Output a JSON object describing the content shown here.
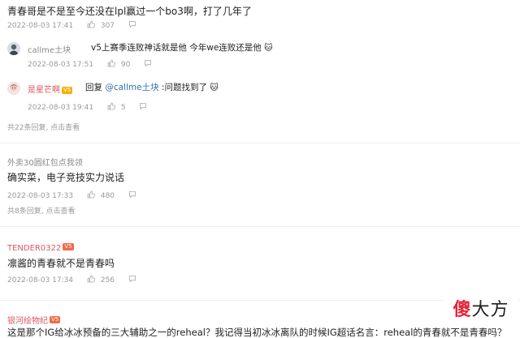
{
  "comments": [
    {
      "text": "青春哥是不是至今还没在lpl赢过一个bo3啊，打了几年了",
      "date": "2022-08-03 17:41",
      "likes": "307",
      "replies": [
        {
          "username": "callme土块",
          "content": "v5上赛季连败神话就是他 今年we连败还是他",
          "emoji": "🐱",
          "date": "2022-08-03 17:51",
          "likes": "90"
        },
        {
          "username": "是星芒啊",
          "badge": "V5",
          "reply_word": "回复",
          "mention": "@callme土块",
          "content": ":问题找到了",
          "emoji": "🐱",
          "date": "2022-08-03 19:41",
          "likes": "5"
        }
      ],
      "more_replies": "共22条回复, 点击查看"
    },
    {
      "username": "外卖30圆红包点我领",
      "text": "确实菜，电子竞技实力说话",
      "date": "2022-08-03 17:33",
      "likes": "480",
      "more_replies": "共8条回复, 点击查看"
    },
    {
      "username": "TENDER0322",
      "badge": "V5",
      "text": "凛酱的青春就不是青春吗",
      "date": "2022-08-03 17:34",
      "likes": "256"
    },
    {
      "username": "银河绘物纪",
      "badge": "V5",
      "text": "这是那个IG给冰冰预备的三大辅助之一的reheal？我记得当初冰冰离队的时候IG超话名言：reheal的青春就不是青春吗？"
    }
  ],
  "colors": {
    "meta": "#9a9a9a",
    "link": "#2f6fb0",
    "badge": "#f6b000",
    "username_red": "#d65a62"
  },
  "icons": {
    "like": "thumbs-up-icon"
  },
  "watermark": {
    "red_char": "傻",
    "rest": "大方"
  }
}
